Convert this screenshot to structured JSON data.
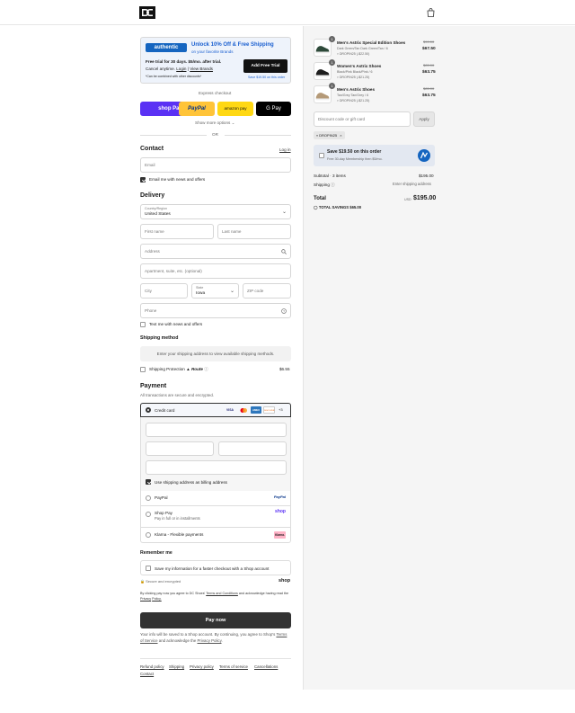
{
  "header": {
    "logo": "DC",
    "cart_icon": "shopping-bag-icon"
  },
  "promo": {
    "brand": "authentic",
    "headline": "Unlock 10% Off & Free Shipping",
    "sub": "on your favorite Brands",
    "trial": "Free trial for 30 days. $5/mo. after trial.",
    "cancel": "Cancel anytime.",
    "login": "Login",
    "sep": "|",
    "view_brands": "View Brands",
    "fine": "*Can be combined with other discounts*",
    "button": "Add Free Trial",
    "save_note": "Save $19.50 on this order"
  },
  "express": {
    "title": "Express checkout",
    "shop_pay": "shop Pay",
    "paypal": "PayPal",
    "amazon": "amazon pay",
    "gpay": "G Pay",
    "more": "Show more options",
    "or": "OR"
  },
  "contact": {
    "title": "Contact",
    "login": "Log in",
    "email_placeholder": "Email",
    "news_label": "Email me with news and offers"
  },
  "delivery": {
    "title": "Delivery",
    "country_label": "Country/Region",
    "country_value": "United States",
    "first_name": "First name",
    "last_name": "Last name",
    "address": "Address",
    "apt": "Apartment, suite, etc. (optional)",
    "city": "City",
    "state_label": "State",
    "state_value": "Iowa",
    "zip": "ZIP code",
    "phone": "Phone",
    "text_label": "Text me with news and offers"
  },
  "shipping": {
    "title": "Shipping method",
    "placeholder": "Enter your shipping address to view available shipping methods.",
    "protection_label": "Shipping Protection",
    "route": "Route",
    "protection_price": "$6.55"
  },
  "payment": {
    "title": "Payment",
    "subtitle": "All transactions are secure and encrypted.",
    "credit_card": "Credit card",
    "cards": [
      "VISA",
      "MC",
      "AMEX",
      "DISCOVER",
      "+3"
    ],
    "billing_label": "Use shipping address as billing address",
    "paypal": "PayPal",
    "paypal_logo": "PayPal",
    "shop_pay": "Shop Pay",
    "shop_pay_sub": "Pay in full or in installments",
    "shop_logo": "shop",
    "klarna": "Klarna - Flexible payments",
    "klarna_logo": "Klarna."
  },
  "remember": {
    "title": "Remember me",
    "label": "Save my information for a faster checkout with a Shop account",
    "secure": "Secure and encrypted",
    "shop_logo": "shop"
  },
  "legal": {
    "prefix": "By clicking pay now you agree to DC Shoes'",
    "terms": "Terms and Conditions",
    "middle": "and acknowledge having read the",
    "privacy": "Privacy",
    "policy_tail": "Policy."
  },
  "pay_now": "Pay now",
  "shop_note": {
    "line1": "Your info will be saved to a Shop account. By continuing, you agree to Shop's",
    "terms": "Terms of Service",
    "middle": "and acknowledge the",
    "privacy": "Privacy Policy",
    "end": "."
  },
  "footer": [
    "Refund policy",
    "Shipping",
    "Privacy policy",
    "Terms of service",
    "Cancellations",
    "Contact"
  ],
  "cart": {
    "items": [
      {
        "qty": "1",
        "name": "Men's Astrix Special Edition Shoes",
        "variant": "Dark Green/Tan Dark Green/Tan / 6",
        "discount": "DROPIN25 (-$22.50)",
        "was": "$90.00",
        "price": "$67.50",
        "color": "#2e4a3a"
      },
      {
        "qty": "1",
        "name": "Women's Astrix Shoes",
        "variant": "Black/Pink Black/Pink / 6",
        "discount": "DROPIN25 (-$21.25)",
        "was": "$85.00",
        "price": "$63.75",
        "color": "#1f1f1f"
      },
      {
        "qty": "1",
        "name": "Men's Astrix Shoes",
        "variant": "Tan/Grey Tan/Grey / 6",
        "discount": "DROPIN25 (-$21.25)",
        "was": "$85.00",
        "price": "$63.75",
        "color": "#b59a78"
      }
    ],
    "discount_placeholder": "Discount code or gift card",
    "apply": "Apply",
    "code_tag": "DROPIN25",
    "save_title": "Save $19.50 on this order",
    "save_sub": "Free 30-day Membership then $5/mo.",
    "subtotal_label": "Subtotal · 3 items",
    "subtotal_value": "$195.00",
    "shipping_label": "Shipping",
    "shipping_value": "Enter shipping address",
    "total_label": "Total",
    "currency": "USD",
    "total_value": "$195.00",
    "savings_label": "TOTAL SAVINGS",
    "savings_value": "$65.00"
  },
  "colors": {
    "accent": "#1a5fd0",
    "shop_purple": "#5a31f4",
    "paypal_yellow": "#ffc439",
    "amazon_yellow": "#ffd814",
    "dark_button": "#333333"
  }
}
